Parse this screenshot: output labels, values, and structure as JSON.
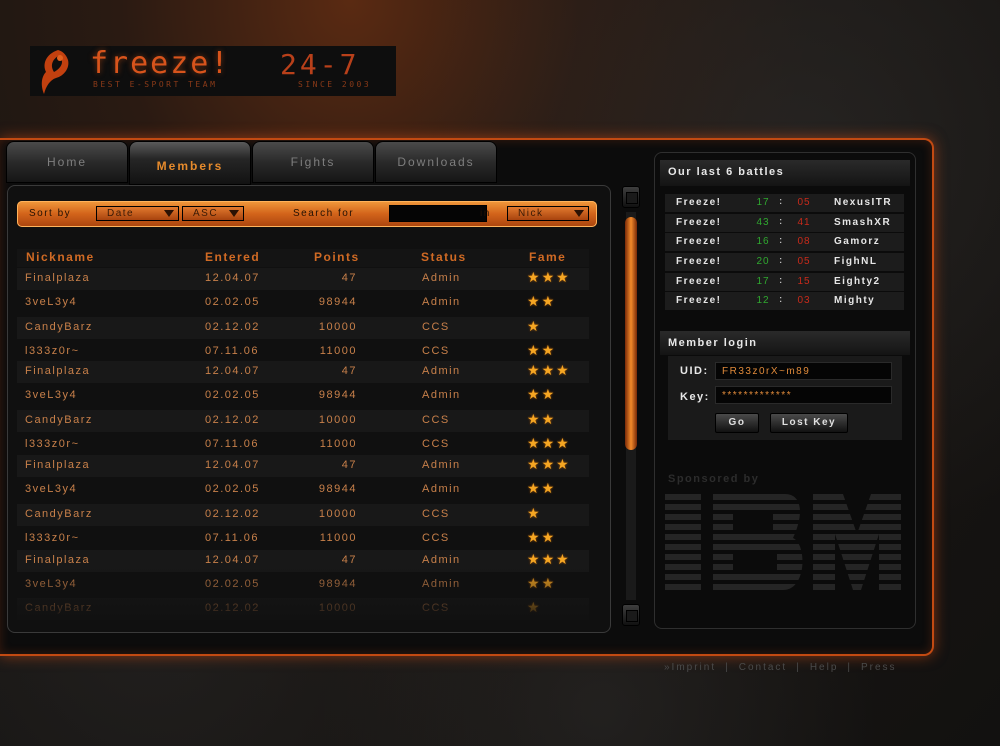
{
  "logo": {
    "title": "freeze!",
    "tagline": "BEST E-SPORT TEAM",
    "hours": "24-7",
    "since": "SINCE 2003",
    "accent_color": "#d8541c"
  },
  "tabs": [
    {
      "label": "Home",
      "active": false
    },
    {
      "label": "Members",
      "active": true
    },
    {
      "label": "Fights",
      "active": false
    },
    {
      "label": "Downloads",
      "active": false
    }
  ],
  "sortbar": {
    "sort_by_label": "Sort by",
    "sort_field": "Date",
    "sort_order": "ASC",
    "search_label": "Search for",
    "search_value": "",
    "in_label": "in",
    "search_field": "Nick"
  },
  "table": {
    "columns": [
      "Nickname",
      "Entered",
      "Points",
      "Status",
      "Fame"
    ],
    "rows": [
      {
        "nickname": "Finalplaza",
        "entered": "12.04.07",
        "points": "47",
        "status": "Admin",
        "fame": 3
      },
      {
        "nickname": "3veL3y4",
        "entered": "02.02.05",
        "points": "98944",
        "status": "Admin",
        "fame": 2
      },
      {
        "nickname": "CandyBarz",
        "entered": "02.12.02",
        "points": "10000",
        "status": "CCS",
        "fame": 1
      },
      {
        "nickname": "l333z0r~",
        "entered": "07.11.06",
        "points": "11000",
        "status": "CCS",
        "fame": 2
      },
      {
        "nickname": "Finalplaza",
        "entered": "12.04.07",
        "points": "47",
        "status": "Admin",
        "fame": 3
      },
      {
        "nickname": "3veL3y4",
        "entered": "02.02.05",
        "points": "98944",
        "status": "Admin",
        "fame": 2
      },
      {
        "nickname": "CandyBarz",
        "entered": "02.12.02",
        "points": "10000",
        "status": "CCS",
        "fame": 2
      },
      {
        "nickname": "l333z0r~",
        "entered": "07.11.06",
        "points": "11000",
        "status": "CCS",
        "fame": 3
      },
      {
        "nickname": "Finalplaza",
        "entered": "12.04.07",
        "points": "47",
        "status": "Admin",
        "fame": 3
      },
      {
        "nickname": "3veL3y4",
        "entered": "02.02.05",
        "points": "98944",
        "status": "Admin",
        "fame": 2
      },
      {
        "nickname": "CandyBarz",
        "entered": "02.12.02",
        "points": "10000",
        "status": "CCS",
        "fame": 1
      },
      {
        "nickname": "l333z0r~",
        "entered": "07.11.06",
        "points": "11000",
        "status": "CCS",
        "fame": 2
      },
      {
        "nickname": "Finalplaza",
        "entered": "12.04.07",
        "points": "47",
        "status": "Admin",
        "fame": 3
      },
      {
        "nickname": "3veL3y4",
        "entered": "02.02.05",
        "points": "98944",
        "status": "Admin",
        "fame": 2
      },
      {
        "nickname": "CandyBarz",
        "entered": "02.12.02",
        "points": "10000",
        "status": "CCS",
        "fame": 1
      }
    ]
  },
  "battles": {
    "title": "Our last 6 battles",
    "items": [
      {
        "team": "Freeze!",
        "score_own": "17",
        "score_opp": "05",
        "opponent": "NexusITR"
      },
      {
        "team": "Freeze!",
        "score_own": "43",
        "score_opp": "41",
        "opponent": "SmashXR"
      },
      {
        "team": "Freeze!",
        "score_own": "16",
        "score_opp": "08",
        "opponent": "Gamorz"
      },
      {
        "team": "Freeze!",
        "score_own": "20",
        "score_opp": "05",
        "opponent": "FighNL"
      },
      {
        "team": "Freeze!",
        "score_own": "17",
        "score_opp": "15",
        "opponent": "Eighty2"
      },
      {
        "team": "Freeze!",
        "score_own": "12",
        "score_opp": "03",
        "opponent": "Mighty"
      }
    ]
  },
  "login": {
    "title": "Member login",
    "uid_label": "UID:",
    "uid_value": "FR33z0rX~m89",
    "key_label": "Key:",
    "key_value": "*************",
    "go_label": "Go",
    "lost_key_label": "Lost Key"
  },
  "sponsor": {
    "label": "Sponsored by",
    "name": "IBM"
  },
  "footer": {
    "links": [
      "»Imprint",
      "Contact",
      "Help",
      "Press"
    ],
    "separator": "|"
  }
}
